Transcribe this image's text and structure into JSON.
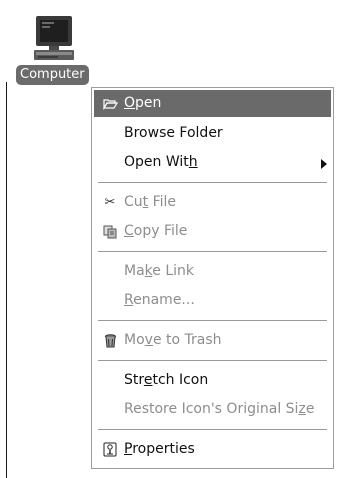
{
  "desktop": {
    "icon_label": "Computer",
    "icon_name": "computer-icon"
  },
  "menu": {
    "open": {
      "pre": "",
      "key": "O",
      "post": "pen",
      "icon": "folder-open-icon"
    },
    "browse_folder": {
      "label": "Browse Folder"
    },
    "open_with": {
      "pre": "Open Wit",
      "key": "h",
      "post": "",
      "icon": "chevron-right-icon"
    },
    "cut_file": {
      "pre": "Cu",
      "key": "t",
      "post": " File",
      "icon": "scissors-icon"
    },
    "copy_file": {
      "pre": "",
      "key": "C",
      "post": "opy File",
      "icon": "copy-icon"
    },
    "make_link": {
      "pre": "Ma",
      "key": "k",
      "post": "e Link"
    },
    "rename": {
      "pre": "",
      "key": "R",
      "post": "ename..."
    },
    "move_to_trash": {
      "pre": "Mo",
      "key": "v",
      "post": "e to Trash",
      "icon": "trash-icon"
    },
    "stretch_icon": {
      "pre": "Str",
      "key": "e",
      "post": "tch Icon"
    },
    "restore_icon": {
      "pre": "Restore Icon's Original Si",
      "key": "z",
      "post": "e"
    },
    "properties": {
      "pre": "",
      "key": "P",
      "post": "roperties",
      "icon": "properties-icon"
    }
  },
  "colors": {
    "highlight": "#6a6a6a",
    "disabled_text": "#8d8d8d",
    "label_bg": "#6b6b6b"
  }
}
